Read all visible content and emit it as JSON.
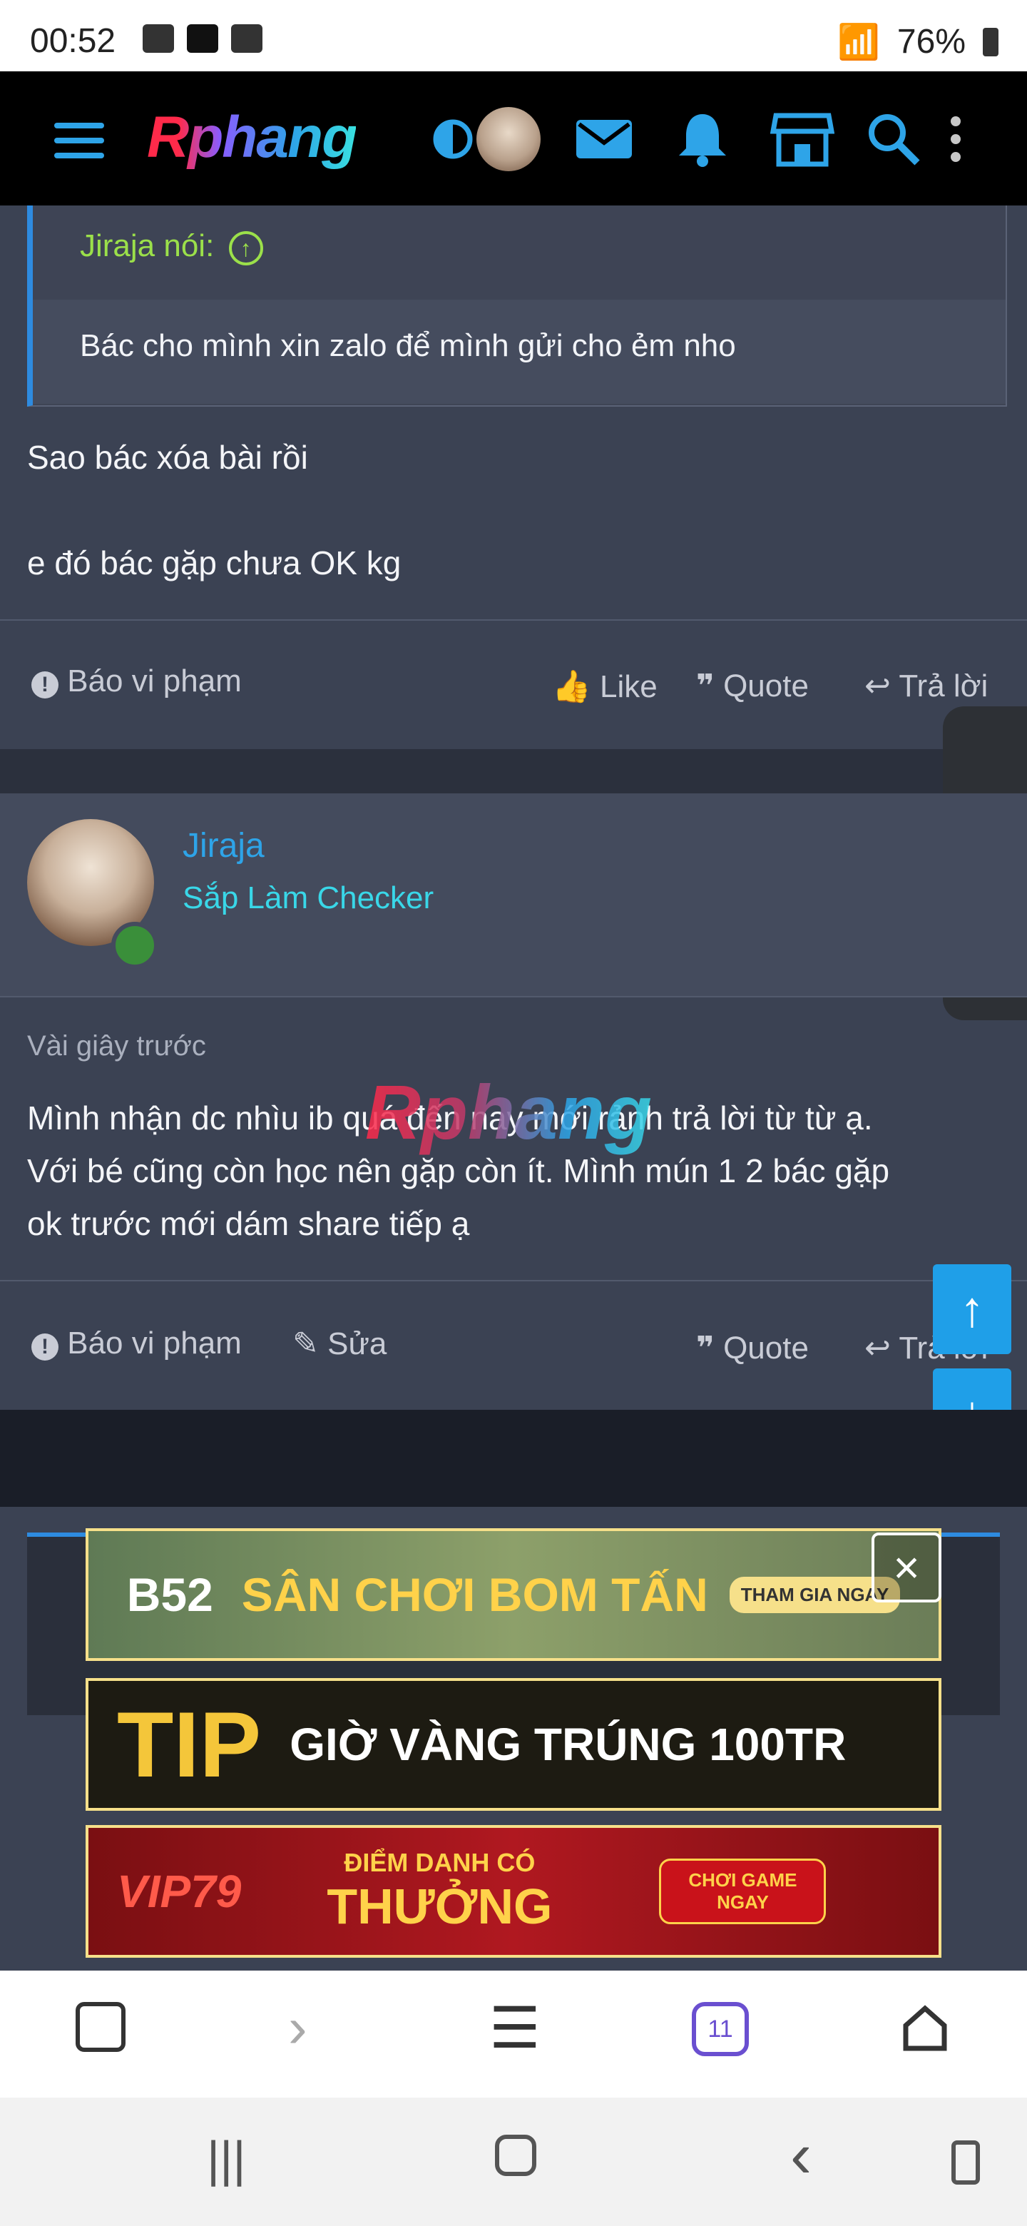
{
  "status_bar": {
    "time": "00:52",
    "battery": "76%"
  },
  "header": {
    "logo": "Rphang"
  },
  "quote": {
    "author_line": "Jiraja nói:",
    "text": "Bác cho mình xin zalo để mình gửi cho ẻm nho"
  },
  "post1": {
    "line1": "Sao bác xóa bài rồi",
    "line2": "e đó bác gặp chưa OK kg",
    "actions": {
      "report": "Báo vi phạm",
      "like": "Like",
      "quote": "Quote",
      "reply": "Trả lời"
    }
  },
  "post2": {
    "username": "Jiraja",
    "user_title": "Sắp Làm Checker",
    "time_ago": "Vài giây trước",
    "body_lines": [
      "Mình nhận dc nhìu ib quá đến nay mới rảnh trả lời từ từ ạ.",
      "Với bé cũng còn học nên gặp còn ít. Mình mún 1 2 bác gặp",
      "ok trước mới dám share tiếp ạ"
    ],
    "actions": {
      "report": "Báo vi phạm",
      "edit": "Sửa",
      "quote": "Quote",
      "reply": "Trả lời"
    }
  },
  "watermark": "Rphang",
  "ads": {
    "ad1": "SÂN CHƠI BOM TẤN",
    "ad1_brand": "B52",
    "ad1_cta": "THAM GIA NGAY",
    "ad2": "GIỜ VÀNG TRÚNG 100TR",
    "ad2_brand": "TIP",
    "ad3_brand": "VIP79",
    "ad3_top": "ĐIỂM DANH CÓ",
    "ad3_main": "THƯỞNG",
    "ad3_cta": "CHƠI GAME NGAY"
  },
  "browser": {
    "tab_count": "11"
  },
  "icons": {
    "menu": "hamburger-icon",
    "theme": "contrast-icon",
    "mail": "mail-icon",
    "bell": "bell-icon",
    "store": "store-icon",
    "search": "search-icon",
    "more": "more-vertical-icon",
    "up": "arrow-up-icon",
    "down": "arrow-down-icon"
  },
  "colors": {
    "accent": "#2ea4e8",
    "background": "#3b4253",
    "quote_author": "#9be04a",
    "user_title": "#39d7e8"
  }
}
